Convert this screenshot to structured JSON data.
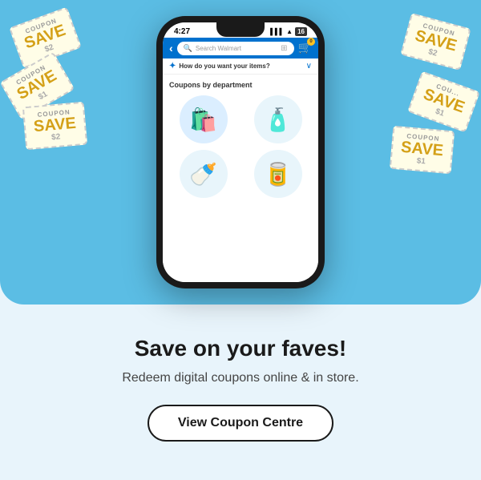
{
  "colors": {
    "top_bg": "#5bbde4",
    "bottom_bg": "#e8f4fb",
    "phone_body": "#1a1a1a",
    "walmart_blue": "#0071ce",
    "accent_yellow": "#ffc220"
  },
  "phone": {
    "status_time": "4:27",
    "search_placeholder": "Search Walmart",
    "cart_count": "0",
    "delivery_question": "How do you want your items?",
    "dept_section_title": "Coupons by department",
    "departments": [
      {
        "name": "grocery",
        "emoji": "🛍️"
      },
      {
        "name": "cleaning",
        "emoji": "🧴"
      },
      {
        "name": "baby",
        "emoji": "🍼"
      },
      {
        "name": "canned",
        "emoji": "🥫"
      }
    ]
  },
  "coupons": [
    {
      "label": "COUPON",
      "save": "SAVE",
      "amount": "$2",
      "sub": "SAVE"
    },
    {
      "label": "COUPON",
      "save": "SAVE",
      "amount": "$1",
      "sub": ""
    },
    {
      "label": "COUPON",
      "save": "SAVE",
      "amount": "$2",
      "sub": "SAVE"
    },
    {
      "label": "COU...",
      "save": "SAVE",
      "amount": "$1",
      "sub": "SAVE"
    }
  ],
  "content": {
    "headline": "Save on your faves!",
    "subtext": "Redeem digital coupons online & in store.",
    "cta_label": "View Coupon Centre"
  }
}
